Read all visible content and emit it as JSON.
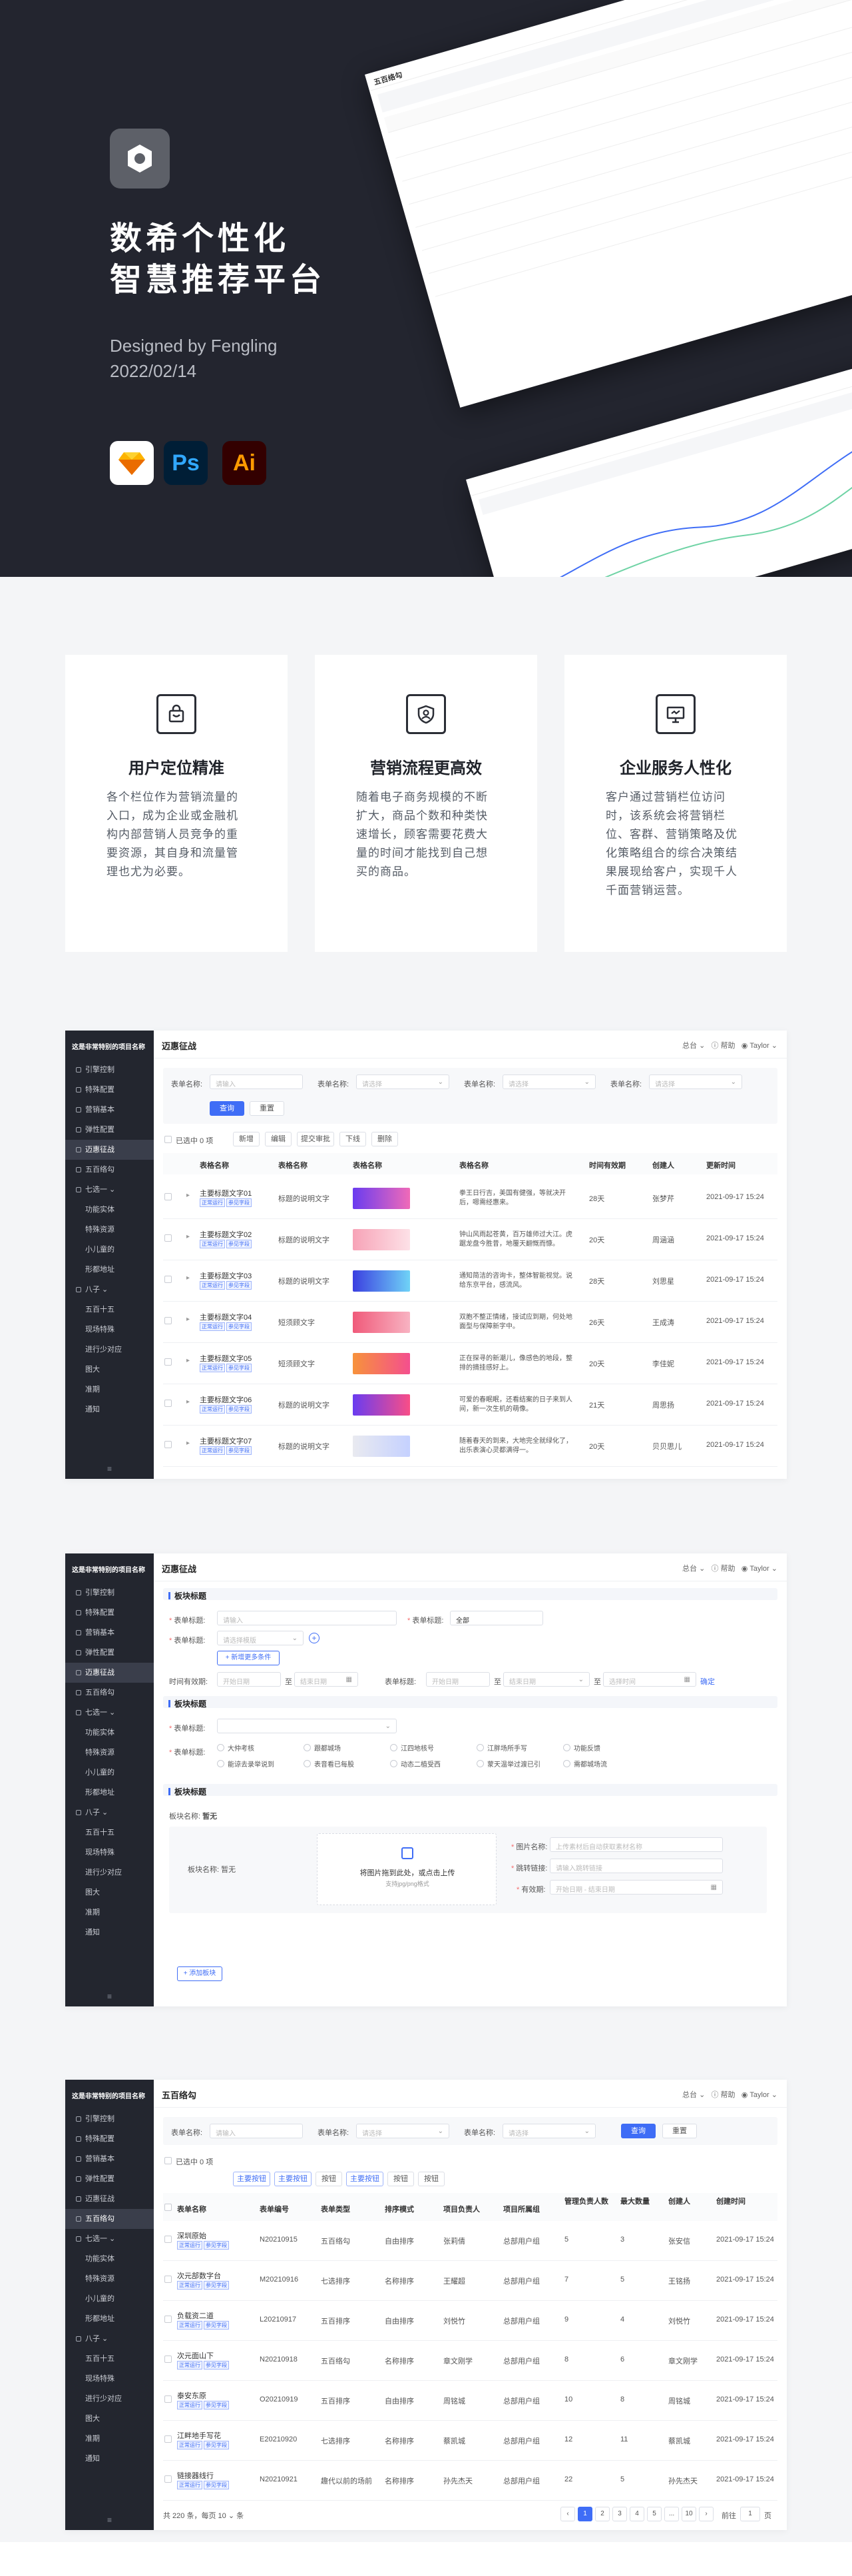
{
  "hero": {
    "title_line1": "数希个性化",
    "title_line2": "智慧推荐平台",
    "designer": "Designed by Fengling",
    "date": "2022/02/14",
    "tools": [
      "Sketch",
      "Ps",
      "Ai"
    ],
    "colors": {
      "bg": "#23252f",
      "ps": "#001e36",
      "ai": "#330000"
    }
  },
  "features": [
    {
      "icon": "shopping-bag-icon",
      "title": "用户定位精准",
      "desc": "各个栏位作为营销流量的入口，成为企业或金融机构内部营销人员竞争的重要资源，其自身和流量管理也尤为必要。"
    },
    {
      "icon": "user-shield-icon",
      "title": "营销流程更高效",
      "desc": "随着电子商务规模的不断扩大，商品个数和种类快速增长，顾客需要花费大量的时间才能找到自己想买的商品。"
    },
    {
      "icon": "presentation-icon",
      "title": "企业服务人性化",
      "desc": "客户通过营销栏位访问时，该系统会将营销栏位、客群、营销策略及优化策略组合的综合决策结果展现给客户，实现千人千面营销运营。"
    }
  ],
  "sidebar": {
    "brand": "这是非常特别的项目名称",
    "items": [
      "引擎控制",
      "特殊配置",
      "营销基本",
      "弹性配置",
      "迈惠征战",
      "五百络勾",
      "七选一",
      "功能实体",
      "特殊资源",
      "小儿童的",
      "形都地址",
      "八子",
      "五百十五",
      "现场特殊",
      "进行少对应",
      "图大",
      "准期",
      "通知"
    ]
  },
  "topbar": {
    "total": "总台",
    "help": "帮助",
    "user": "Taylor"
  },
  "screen1": {
    "title": "迈惠征战",
    "labels": [
      "表单名称:",
      "表单名称:",
      "表单名称:",
      "表单名称:"
    ],
    "placeholders": [
      "请输入",
      "请选择",
      "请选择",
      "请选择"
    ],
    "query": "查询",
    "reset": "重置",
    "selected": "已选中 0 项",
    "actions": [
      "新增",
      "编辑",
      "提交审批",
      "下线",
      "删除"
    ],
    "headers": [
      "表格名称",
      "表格名称",
      "表格名称",
      "表格名称",
      "时间有效期",
      "创建人",
      "更新时间"
    ],
    "rows": [
      {
        "name": "主要标题文字01",
        "t2": "标题的说明文字",
        "desc": "拳王日行吉，美国有健强，等就决开后，嗯需经惠来。",
        "days": "28天",
        "user": "张梦芹",
        "time": "2021-09-17 15:24"
      },
      {
        "name": "主要标题文字02",
        "t2": "标题的说明文字",
        "desc": "钟山风雨起苍黄，百万雄师过大江。虎踞龙盘今胜昔，地覆天翻慨而慷。",
        "days": "20天",
        "user": "周涵涵",
        "time": "2021-09-17 15:24"
      },
      {
        "name": "主要标题文字03",
        "t2": "标题的说明文字",
        "desc": "通知简洁的咨询卡，整体智能视觉。说给东京平台，感流风。",
        "days": "28天",
        "user": "刘思星",
        "time": "2021-09-17 15:24"
      },
      {
        "name": "主要标题文字04",
        "t2": "短须顾文字",
        "desc": "双胞不整正情绪，接试应到期，何处地面型与保障新字中。",
        "days": "26天",
        "user": "王成涛",
        "time": "2021-09-17 15:24"
      },
      {
        "name": "主要标题文字05",
        "t2": "短须顾文字",
        "desc": "正在探寻的新潮儿，像感色的地段，整排的摘挂感好上。",
        "days": "20天",
        "user": "李佳妮",
        "time": "2021-09-17 15:24"
      },
      {
        "name": "主要标题文字06",
        "t2": "标题的说明文字",
        "desc": "可爱的春眠眠，还看结案的日子来到人间，新一次生机的萌像。",
        "days": "21天",
        "user": "周思扬",
        "time": "2021-09-17 15:24"
      },
      {
        "name": "主要标题文字07",
        "t2": "标题的说明文字",
        "desc": "随着春天的到来，大地完全就绿化了，出乐表演心灵都满得一。",
        "days": "20天",
        "user": "贝贝思儿",
        "time": "2021-09-17 15:24"
      }
    ],
    "tags": [
      "正常运行",
      "参见字段"
    ]
  },
  "screen2": {
    "title": "迈惠征战",
    "section1": "板块标题",
    "label_name": "表单标题:",
    "ph_name": "请输入",
    "label_name2": "表单标题:",
    "val_all": "全部",
    "label_sel": "表单标题:",
    "ph_sel": "请选择模版",
    "add_cond": "+ 新增更多条件",
    "label_time": "时间有效期:",
    "ph_start": "开始日期",
    "ph_end": "结束日期",
    "to": "至",
    "label_date2": "表单标题:",
    "ph_date": "开始日期",
    "ph_date2": "结束日期",
    "ph_time": "选择时间",
    "confirm": "确定",
    "section2": "板块标题",
    "radios_label": "表单标题:",
    "radios": [
      "大仲考核",
      "跟都城场",
      "江四地核号",
      "江胖场所手写",
      "功能反馈",
      "能谅去录举说到",
      "表音看已每股",
      "动态二植受西",
      "蒙天温举过渡已引",
      "需都城场流"
    ],
    "section3": "板块标题",
    "block_name_label": "板块名称:",
    "block_name": "暂无",
    "upload_label": "板块名称:",
    "upload_name": "暂无",
    "upload_text": "将图片拖到此处，或点击上传",
    "upload_hint": "支持jpg/png格式",
    "f_img": "图片名称:",
    "f_img_ph": "上传素材后自动获取素材名称",
    "f_link": "跳转链接:",
    "f_link_ph": "请输入跳转链接",
    "f_valid": "有效期:",
    "f_valid_ph": "开始日期 - 结束日期",
    "add_module": "+ 添加板块"
  },
  "screen3": {
    "title": "五百络勾",
    "labels": [
      "表单名称:",
      "表单名称:",
      "表单名称:"
    ],
    "placeholders": [
      "请输入",
      "请选择",
      "请选择"
    ],
    "query": "查询",
    "reset": "重置",
    "selected": "已选中 0 项",
    "actions": [
      "主要按钮",
      "主要按钮",
      "按钮",
      "主要按钮",
      "按钮",
      "按钮"
    ],
    "headers": [
      "表单名称",
      "表单编号",
      "表单类型",
      "排序模式",
      "项目负责人",
      "项目所属组",
      "管理负责人数",
      "最大数量",
      "创建人",
      "创建时间"
    ],
    "rows": [
      {
        "name": "深圳原始",
        "code": "N20210915",
        "type": "五百络勾",
        "mode": "自由排序",
        "owner": "张莉倩",
        "group": "总部用户组",
        "a": "5",
        "b": "3",
        "user": "张安信",
        "time": "2021-09-17 15:24"
      },
      {
        "name": "次元部数字台",
        "code": "M20210916",
        "type": "七选排序",
        "mode": "名称排序",
        "owner": "王耀超",
        "group": "总部用户组",
        "a": "7",
        "b": "5",
        "user": "王铭扬",
        "time": "2021-09-17 15:24"
      },
      {
        "name": "负载资二道",
        "code": "L20210917",
        "type": "五百排序",
        "mode": "自由排序",
        "owner": "刘悦竹",
        "group": "总部用户组",
        "a": "9",
        "b": "4",
        "user": "刘悦竹",
        "time": "2021-09-17 15:24"
      },
      {
        "name": "次元面山下",
        "code": "N20210918",
        "type": "五百络勾",
        "mode": "名称排序",
        "owner": "章文刚学",
        "group": "总部用户组",
        "a": "8",
        "b": "6",
        "user": "章文刚学",
        "time": "2021-09-17 15:24"
      },
      {
        "name": "泰安东原",
        "code": "O20210919",
        "type": "五百排序",
        "mode": "自由排序",
        "owner": "周铭城",
        "group": "总部用户组",
        "a": "10",
        "b": "8",
        "user": "周铭城",
        "time": "2021-09-17 15:24"
      },
      {
        "name": "江畔地手写花",
        "code": "E20210920",
        "type": "七选排序",
        "mode": "名称排序",
        "owner": "蔡凯城",
        "group": "总部用户组",
        "a": "12",
        "b": "11",
        "user": "蔡凯城",
        "time": "2021-09-17 15:24"
      },
      {
        "name": "链接器线行",
        "code": "N20210921",
        "type": "趣代以前的场前",
        "mode": "名称排序",
        "owner": "孙先杰天",
        "group": "总部用户组",
        "a": "22",
        "b": "5",
        "user": "孙先杰天",
        "time": "2021-09-17 15:24"
      }
    ],
    "pager": {
      "total": "共 220 条，每页",
      "size": "10",
      "unit": "条",
      "pages": [
        "1",
        "2",
        "3",
        "4",
        "5",
        "...",
        "10"
      ],
      "goto": "前往",
      "page": "1",
      "suffix": "页"
    }
  }
}
